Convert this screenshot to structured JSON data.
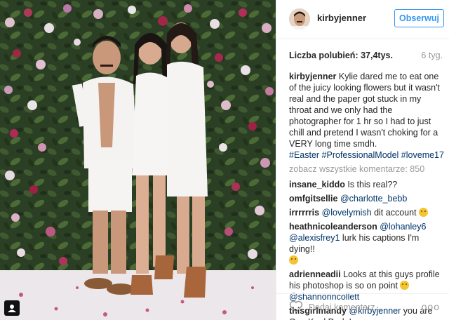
{
  "post": {
    "username": "kirbyjenner",
    "follow_label": "Obserwuj",
    "likes": "Liczba polubień: 37,4tys.",
    "age": "6 tyg.",
    "caption": {
      "user": "kirbyjenner",
      "text": " Kylie dared me to eat one of the juicy looking flowers but it wasn't real and the paper got stuck in my throat and we only had the photographer for 1 hr so I had to just chill and pretend I wasn't choking for a VERY long time smdh.",
      "hashtags": "#Easter #ProfessionalModel #loveme17"
    },
    "view_all": "zobacz wszystkie komentarze: 850",
    "comments": [
      {
        "user": "insane_kiddo",
        "text": " Is this real??"
      },
      {
        "user": "omfgitsellie",
        "mention": " @charlotte_bebb"
      },
      {
        "user": "irrrrrris",
        "mention": " @lovelymish",
        "text": " dit account",
        "emoji": "laughing-emoji"
      },
      {
        "user": "heathnicoleanderson",
        "mention": " @lohanley6",
        "mention2": "@alexisfrey1",
        "text": " lurk his captions I'm dying!!",
        "emoji": "laughing-emoji"
      },
      {
        "user": "adrienneadii",
        "text": " Looks at this guys profile his photoshop is so on point",
        "emoji": "laughing-emoji",
        "mention": "@shannonncollett"
      },
      {
        "user": "thisgirlmandy",
        "mention": " @kirbyjenner",
        "text": " you are One Kool Dude!"
      }
    ],
    "add_comment_placeholder": "Dodaj komentarz...",
    "more_label": "ooo"
  }
}
